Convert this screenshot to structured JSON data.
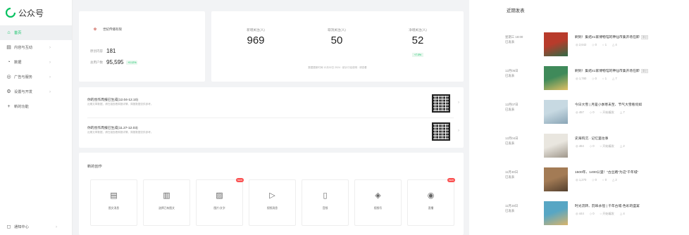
{
  "brand": {
    "name": "公众号",
    "color": "#07c160"
  },
  "sidebar": {
    "items": [
      {
        "label": "首页",
        "icon": "home-icon",
        "active": true
      },
      {
        "label": "内容与互动",
        "icon": "document-icon",
        "arrow": true
      },
      {
        "label": "数据",
        "icon": "chart-icon",
        "arrow": true
      },
      {
        "label": "广告与服务",
        "icon": "ad-icon",
        "arrow": true
      },
      {
        "label": "设置与开发",
        "icon": "settings-icon",
        "arrow": true
      },
      {
        "label": "新的功能",
        "icon": "plus-icon"
      }
    ],
    "help": {
      "label": "通知中心",
      "icon": "bell-icon"
    }
  },
  "account": {
    "name": "世纪传播有限",
    "rows": [
      {
        "label": "原创内容",
        "value": "181"
      },
      {
        "label": "总用户数",
        "value": "95,595",
        "tag": "+0.12%"
      }
    ]
  },
  "stats": {
    "items": [
      {
        "label": "新增关注(人)",
        "value": "969"
      },
      {
        "label": "取消关注(人)",
        "value": "50"
      },
      {
        "label": "净增关注(人)",
        "value": "52",
        "badge": "+7.0%"
      }
    ],
    "note": "数据更新时间 12月02日 2024 · 统计口径说明 · 请查看"
  },
  "reports": [
    {
      "title": "你的创作周报已生成(12.04-12.10)",
      "subtitle": "近期文章数据，请扫描查看周报详情，周报数据仅供参考。"
    },
    {
      "title": "你的创作周报已生成(11.27-12.03)",
      "subtitle": "近期文章数据，请扫描查看周报详情，周报数据仅供参考。"
    }
  ],
  "create": {
    "title": "新的创作",
    "tiles": [
      {
        "label": "图文消息",
        "icon": "article-icon",
        "glyph": "▤"
      },
      {
        "label": "选择已有图文",
        "icon": "library-icon",
        "glyph": "▥"
      },
      {
        "label": "图片/文字",
        "icon": "image-icon",
        "glyph": "▨",
        "new": "NEW"
      },
      {
        "label": "视频消息",
        "icon": "video-icon",
        "glyph": "▷"
      },
      {
        "label": "音频",
        "icon": "audio-icon",
        "glyph": "▯"
      },
      {
        "label": "视频号",
        "icon": "channels-icon",
        "glyph": "◈"
      },
      {
        "label": "直播",
        "icon": "live-icon",
        "glyph": "◉",
        "new": "NEW"
      }
    ]
  },
  "recent": {
    "title": "近期发表",
    "posts": [
      {
        "date": "星期三 18:00",
        "status": "已发表",
        "title": "刷到！集结41家博物馆的神仙市集开场在即",
        "orig": "原创",
        "stats": [
          "2,642",
          "0",
          "1",
          "4"
        ],
        "thumb": [
          "#b83b2b",
          "#2f6b46"
        ]
      },
      {
        "date": "12月06日",
        "status": "已发表",
        "title": "刷到！集结41家博物馆的神仙市集开场在即",
        "orig": "原创",
        "stats": [
          "1,780",
          "0",
          "1",
          "7"
        ],
        "thumb": [
          "#3f8a5a",
          "#e0c063"
        ]
      },
      {
        "date": "12月07日",
        "status": "已发表",
        "title": "今日大雪 | 月是小季寒未至、节气大雪看何如",
        "stats": [
          "457",
          "0",
          "开始编发",
          "7"
        ],
        "thumb": [
          "#c7d9e2",
          "#8aa5b6"
        ]
      },
      {
        "date": "12月04日",
        "status": "已发表",
        "title": "史海钩沉 · 记忆里往事",
        "stats": [
          "464",
          "0",
          "开始编发",
          "2"
        ],
        "thumb": [
          "#e9e6df",
          "#9f978b"
        ]
      },
      {
        "date": "11月30日",
        "status": "已发表",
        "title": "1500年、1400公里！“古丝路”为这“千年城”",
        "stats": [
          "1,270",
          "0",
          "0",
          "2"
        ],
        "thumb": [
          "#a37b55",
          "#54402e"
        ]
      },
      {
        "date": "11月28日",
        "status": "已发表",
        "title": "时光流转、韵味永恒 | 千年古城·色彩的盛宴",
        "stats": [
          "444",
          "0",
          "开始编发",
          "4"
        ],
        "thumb": [
          "#57a6c4",
          "#d9b46a"
        ]
      }
    ]
  }
}
